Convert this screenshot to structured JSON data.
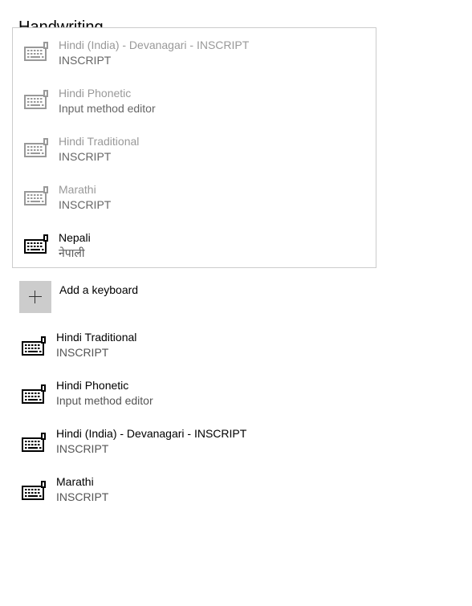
{
  "section": {
    "heading": "Handwriting"
  },
  "flyout": {
    "items": [
      {
        "name": "Hindi (India) - Devanagari - INSCRIPT",
        "sub": "INSCRIPT",
        "state": "disabled",
        "icon": "keyboard-icon"
      },
      {
        "name": "Hindi Phonetic",
        "sub": "Input method editor",
        "state": "disabled",
        "icon": "keyboard-icon"
      },
      {
        "name": "Hindi Traditional",
        "sub": "INSCRIPT",
        "state": "disabled",
        "icon": "keyboard-icon"
      },
      {
        "name": "Marathi",
        "sub": "INSCRIPT",
        "state": "disabled",
        "icon": "keyboard-icon"
      },
      {
        "name": "Nepali",
        "sub": "नेपाली",
        "state": "enabled",
        "icon": "keyboard-icon"
      }
    ]
  },
  "add_keyboard": {
    "label": "Add a keyboard",
    "icon": "plus-icon"
  },
  "keyboards": [
    {
      "name": "Hindi Traditional",
      "sub": "INSCRIPT",
      "icon": "keyboard-icon"
    },
    {
      "name": "Hindi Phonetic",
      "sub": "Input method editor",
      "icon": "keyboard-icon"
    },
    {
      "name": "Hindi (India) - Devanagari - INSCRIPT",
      "sub": "INSCRIPT",
      "icon": "keyboard-icon"
    },
    {
      "name": "Marathi",
      "sub": "INSCRIPT",
      "icon": "keyboard-icon"
    }
  ],
  "colors": {
    "disabled_icon": "#999999",
    "enabled_icon": "#000000",
    "tile_bg": "#cccccc",
    "flyout_border": "#cccccc"
  }
}
